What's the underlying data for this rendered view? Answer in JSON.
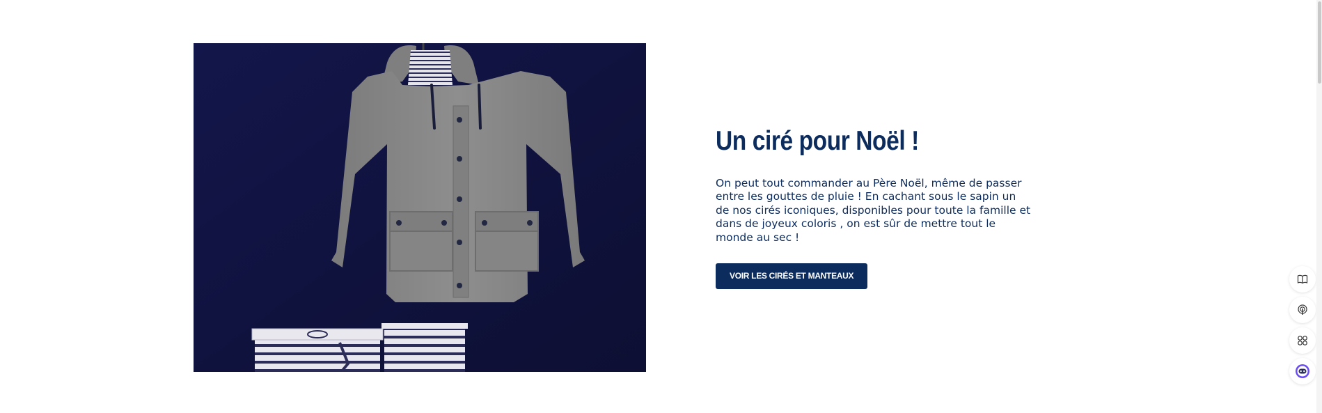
{
  "hero": {
    "image_alt": "Ciré gris suspendu avec boîtes cadeaux rayées",
    "title": "Un ciré pour Noël !",
    "paragraph": "On peut tout commander au Père Noël, même de passer entre les gouttes de pluie ! En cachant sous le sapin un de nos cirés iconiques, disponibles pour toute la famille et dans de joyeux coloris , on est sûr de mettre tout le monde au sec !",
    "cta_label": "VOIR LES CIRÉS ET MANTEAUX"
  },
  "floating_tools": [
    {
      "icon": "book-icon"
    },
    {
      "icon": "podcast-icon"
    },
    {
      "icon": "apps-grid-icon"
    },
    {
      "icon": "chatbot-icon"
    }
  ],
  "colors": {
    "navy": "#0d2c5e",
    "image_background": "#12143d",
    "coat_gray": "#8a8a8a"
  }
}
